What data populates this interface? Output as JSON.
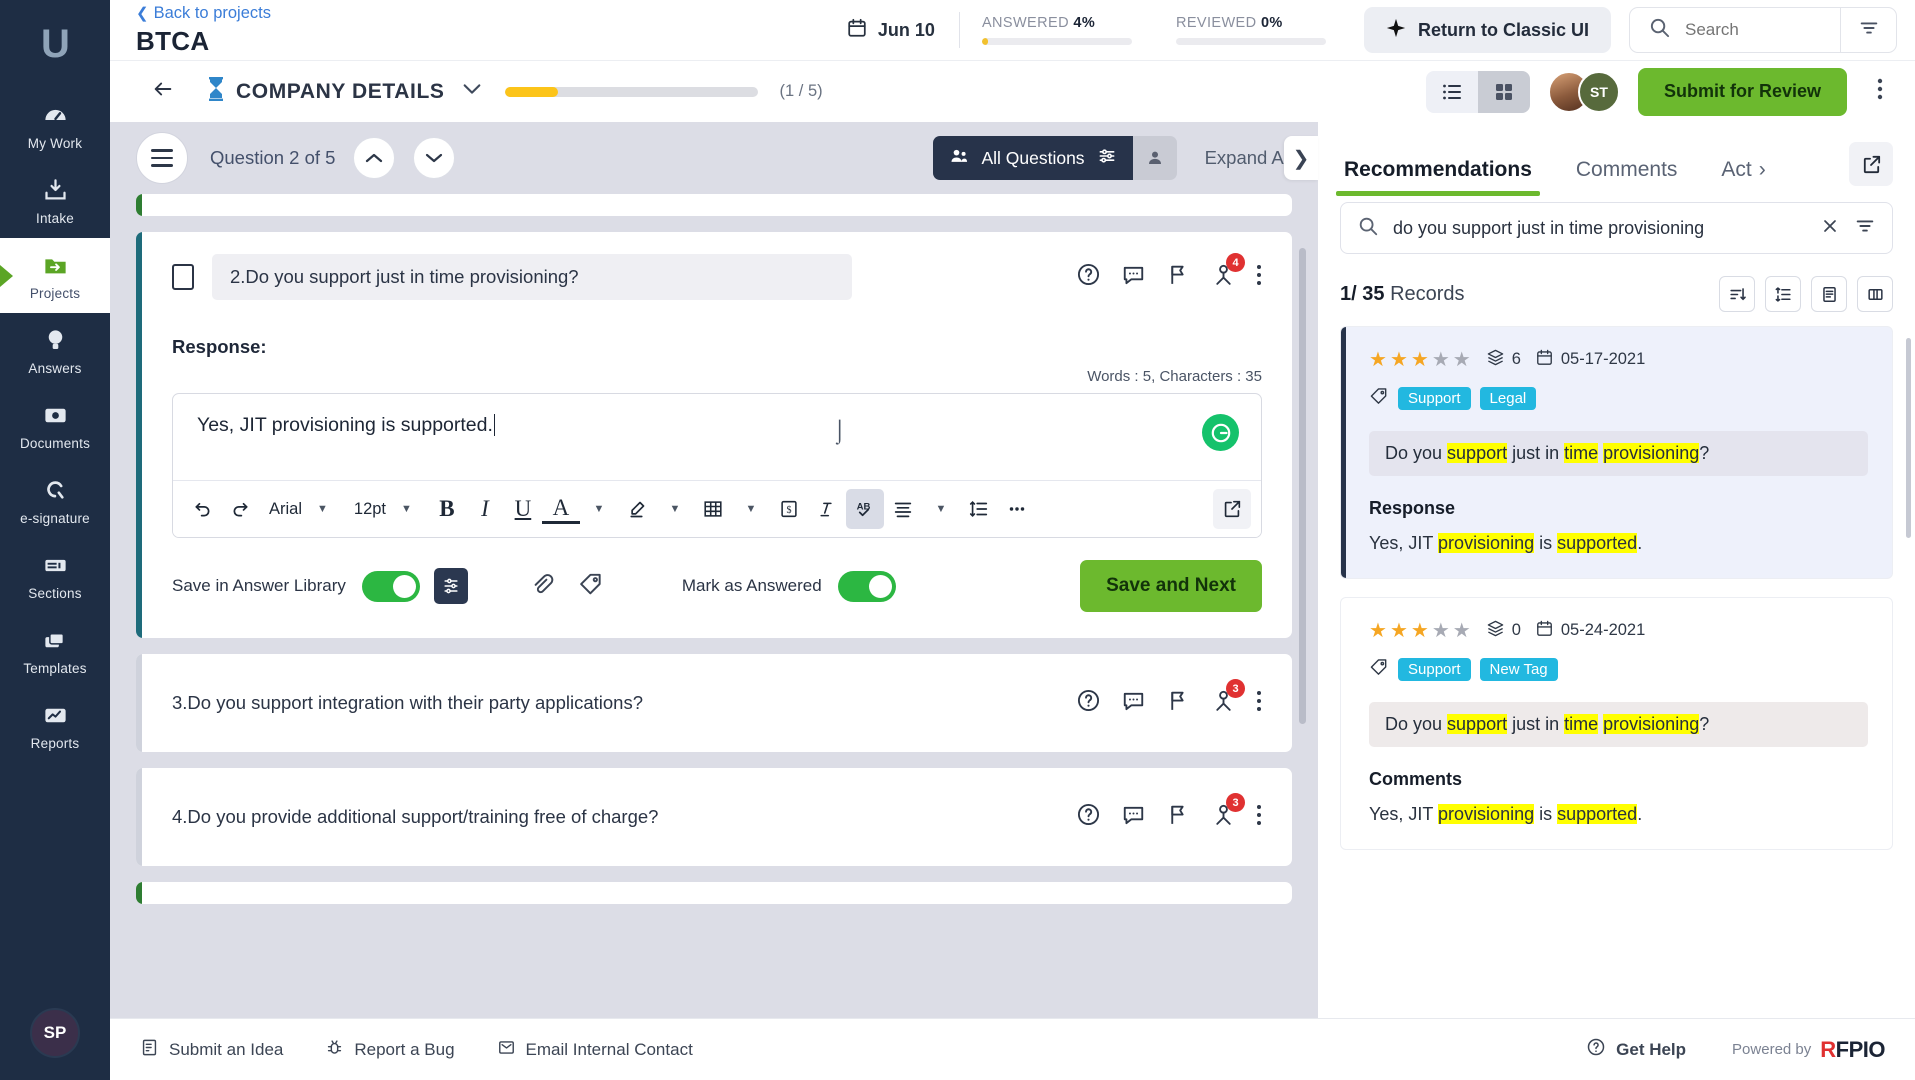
{
  "rail": {
    "logo": "U",
    "items": [
      {
        "label": "My Work",
        "icon": "gauge-icon"
      },
      {
        "label": "Intake",
        "icon": "inbox-down-icon"
      },
      {
        "label": "Projects",
        "icon": "folder-arrow-icon",
        "active": true
      },
      {
        "label": "Answers",
        "icon": "lightbulb-icon"
      },
      {
        "label": "Documents",
        "icon": "document-icon"
      },
      {
        "label": "e-signature",
        "icon": "signature-icon"
      },
      {
        "label": "Sections",
        "icon": "sections-icon"
      },
      {
        "label": "Templates",
        "icon": "templates-icon"
      },
      {
        "label": "Reports",
        "icon": "reports-icon"
      }
    ],
    "avatar_initials": "SP"
  },
  "header": {
    "back_link": "Back to projects",
    "project_title": "BTCA",
    "date": "Jun 10",
    "stats": [
      {
        "label": "ANSWERED",
        "value": "4%",
        "pct": 4,
        "color": "#f2c12e"
      },
      {
        "label": "REVIEWED",
        "value": "0%",
        "pct": 0,
        "color": "#b6bac5"
      }
    ],
    "classic_ui_button": "Return to Classic UI",
    "search_placeholder": "Search",
    "search_value": ""
  },
  "section_bar": {
    "title": "COMPANY DETAILS",
    "progress_pct": 21,
    "count": "(1 / 5)",
    "submit_button": "Submit for Review",
    "avatars": [
      {
        "initials": "",
        "type": "photo"
      },
      {
        "initials": "ST",
        "type": "text"
      }
    ]
  },
  "question_nav": {
    "position_label": "Question 2 of 5",
    "all_questions": "All Questions",
    "expand_all": "Expand All"
  },
  "question_card": {
    "number_text": "2.Do you support just in time provisioning?",
    "assignee_badge": "4",
    "response_label": "Response:",
    "word_count": "Words : 5, Characters : 35",
    "editor_text": "Yes, JIT provisioning is supported.",
    "toolbar": {
      "font_family": "Arial",
      "font_size": "12pt"
    },
    "save_library_label": "Save in Answer Library",
    "mark_answered_label": "Mark as Answered",
    "save_next_button": "Save and Next"
  },
  "other_questions": [
    {
      "text": "3.Do you support integration with their party applications?",
      "badge": "3"
    },
    {
      "text": "4.Do you provide additional support/training free of charge?",
      "badge": "3"
    }
  ],
  "right_panel": {
    "tabs": [
      {
        "label": "Recommendations",
        "active": true
      },
      {
        "label": "Comments",
        "active": false
      },
      {
        "label": "Act",
        "active": false,
        "has_chevron": true
      }
    ],
    "search_value": "do you support just in time provisioning",
    "records_count_current": "1/",
    "records_count_total": "35",
    "records_word": "Records",
    "records": [
      {
        "stars_on": 3,
        "stars_total": 5,
        "layers_count": "6",
        "date": "05-17-2021",
        "tags": [
          "Support",
          "Legal"
        ],
        "question_parts": [
          {
            "t": "Do you ",
            "hl": false
          },
          {
            "t": "support",
            "hl": true
          },
          {
            "t": " just in ",
            "hl": false
          },
          {
            "t": "time",
            "hl": true
          },
          {
            "t": " ",
            "hl": false
          },
          {
            "t": "provisioning",
            "hl": true
          },
          {
            "t": "?",
            "hl": false
          }
        ],
        "answer_heading": "Response",
        "answer_parts": [
          {
            "t": "Yes, JIT ",
            "hl": false
          },
          {
            "t": "provisioning",
            "hl": true
          },
          {
            "t": " is ",
            "hl": false
          },
          {
            "t": "supported",
            "hl": true
          },
          {
            "t": ".",
            "hl": false
          }
        ],
        "selected": true
      },
      {
        "stars_on": 3,
        "stars_total": 5,
        "layers_count": "0",
        "date": "05-24-2021",
        "tags": [
          "Support",
          "New Tag"
        ],
        "question_parts": [
          {
            "t": "Do you ",
            "hl": false
          },
          {
            "t": "support",
            "hl": true
          },
          {
            "t": " just in ",
            "hl": false
          },
          {
            "t": "time",
            "hl": true
          },
          {
            "t": " ",
            "hl": false
          },
          {
            "t": "provisioning",
            "hl": true
          },
          {
            "t": "?",
            "hl": false
          }
        ],
        "answer_heading": "Comments",
        "answer_parts": [
          {
            "t": "Yes, JIT ",
            "hl": false
          },
          {
            "t": "provisioning",
            "hl": true
          },
          {
            "t": " is ",
            "hl": false
          },
          {
            "t": "supported",
            "hl": true
          },
          {
            "t": ".",
            "hl": false
          }
        ],
        "selected": false
      }
    ]
  },
  "footer": {
    "items": [
      {
        "label": "Submit an Idea",
        "icon": "idea-note-icon"
      },
      {
        "label": "Report a Bug",
        "icon": "bug-icon"
      },
      {
        "label": "Email Internal Contact",
        "icon": "mail-check-icon"
      }
    ],
    "help": "Get Help",
    "powered_by": "Powered by",
    "brand_prefix": "R",
    "brand_rest": "FPIO"
  }
}
